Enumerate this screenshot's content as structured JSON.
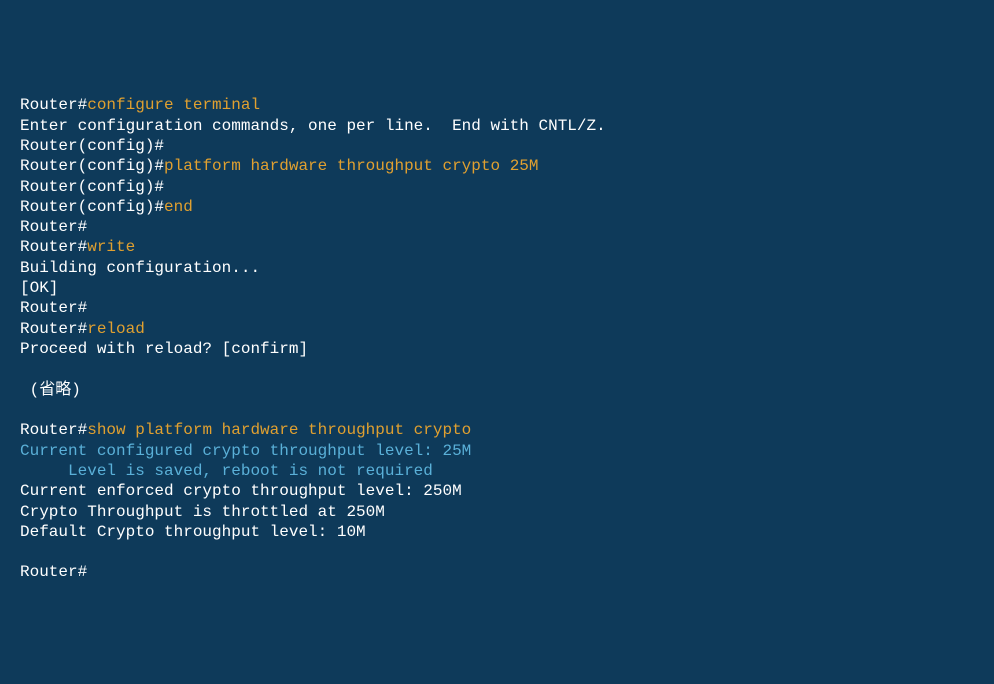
{
  "lines": [
    {
      "segments": [
        {
          "class": "prompt",
          "text": "Router#"
        },
        {
          "class": "cmd",
          "text": "configure terminal"
        }
      ]
    },
    {
      "segments": [
        {
          "class": "output",
          "text": "Enter configuration commands, one per line.  End with CNTL/Z."
        }
      ]
    },
    {
      "segments": [
        {
          "class": "prompt",
          "text": "Router(config)#"
        }
      ]
    },
    {
      "segments": [
        {
          "class": "prompt",
          "text": "Router(config)#"
        },
        {
          "class": "cmd",
          "text": "platform hardware throughput crypto 25M"
        }
      ]
    },
    {
      "segments": [
        {
          "class": "prompt",
          "text": "Router(config)#"
        }
      ]
    },
    {
      "segments": [
        {
          "class": "prompt",
          "text": "Router(config)#"
        },
        {
          "class": "cmd",
          "text": "end"
        }
      ]
    },
    {
      "segments": [
        {
          "class": "prompt",
          "text": "Router#"
        }
      ]
    },
    {
      "segments": [
        {
          "class": "prompt",
          "text": "Router#"
        },
        {
          "class": "cmd",
          "text": "write"
        }
      ]
    },
    {
      "segments": [
        {
          "class": "output",
          "text": "Building configuration..."
        }
      ]
    },
    {
      "segments": [
        {
          "class": "output",
          "text": "[OK]"
        }
      ]
    },
    {
      "segments": [
        {
          "class": "prompt",
          "text": "Router#"
        }
      ]
    },
    {
      "segments": [
        {
          "class": "prompt",
          "text": "Router#"
        },
        {
          "class": "cmd",
          "text": "reload"
        }
      ]
    },
    {
      "segments": [
        {
          "class": "output",
          "text": "Proceed with reload? [confirm]"
        }
      ]
    },
    {
      "segments": [
        {
          "class": "output",
          "text": ""
        }
      ]
    },
    {
      "segments": [
        {
          "class": "output",
          "text": " (省略)"
        }
      ]
    },
    {
      "segments": [
        {
          "class": "output",
          "text": ""
        }
      ]
    },
    {
      "segments": [
        {
          "class": "prompt",
          "text": "Router#"
        },
        {
          "class": "cmd",
          "text": "show platform hardware throughput crypto"
        }
      ]
    },
    {
      "segments": [
        {
          "class": "info",
          "text": "Current configured crypto throughput level: 25M"
        }
      ]
    },
    {
      "segments": [
        {
          "class": "info",
          "text": "     Level is saved, reboot is not required"
        }
      ]
    },
    {
      "segments": [
        {
          "class": "output",
          "text": "Current enforced crypto throughput level: 250M"
        }
      ]
    },
    {
      "segments": [
        {
          "class": "output",
          "text": "Crypto Throughput is throttled at 250M"
        }
      ]
    },
    {
      "segments": [
        {
          "class": "output",
          "text": "Default Crypto throughput level: 10M"
        }
      ]
    },
    {
      "segments": [
        {
          "class": "output",
          "text": ""
        }
      ]
    },
    {
      "segments": [
        {
          "class": "prompt",
          "text": "Router#"
        }
      ]
    }
  ]
}
